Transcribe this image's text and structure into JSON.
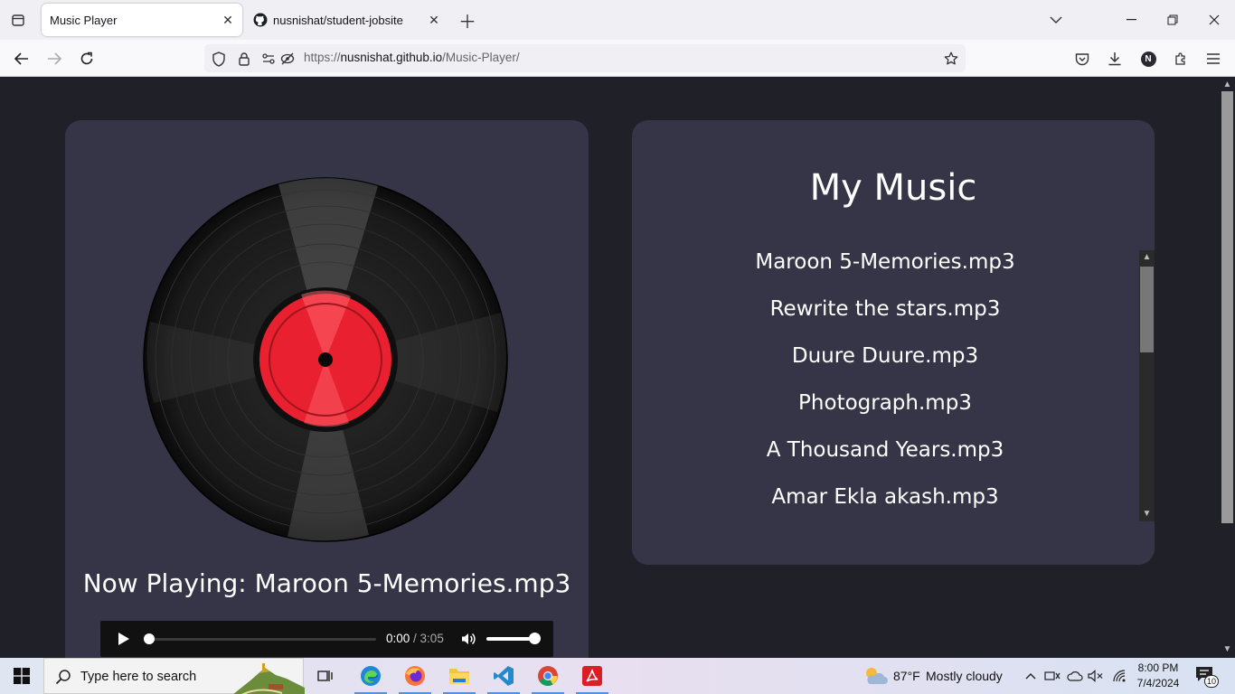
{
  "browser": {
    "tabs": [
      {
        "title": "Music Player",
        "active": true
      },
      {
        "title": "nusnishat/student-jobsite",
        "active": false
      }
    ],
    "url": {
      "scheme": "https://",
      "host": "nusnishat.github.io",
      "path": "/Music-Player/"
    },
    "profile_initial": "N"
  },
  "player": {
    "now_playing": "Now Playing: Maroon 5-Memories.mp3",
    "current_time": "0:00",
    "time_separator": " / ",
    "duration": "3:05",
    "progress_fraction": 0.0,
    "volume_fraction": 1.0
  },
  "music": {
    "title": "My Music",
    "songs": [
      "Maroon 5-Memories.mp3",
      "Rewrite the stars.mp3",
      "Duure Duure.mp3",
      "Photograph.mp3",
      "A Thousand Years.mp3",
      "Amar Ekla akash.mp3"
    ]
  },
  "taskbar": {
    "search_placeholder": "Type here to search",
    "weather_temp": "87°F",
    "weather_text": "Mostly cloudy",
    "time": "8:00 PM",
    "date": "7/4/2024",
    "notification_count": "10",
    "apps": [
      "task-view",
      "edge",
      "firefox",
      "file-explorer",
      "vscode",
      "chrome",
      "acrobat"
    ]
  },
  "colors": {
    "page_bg": "#1f2028",
    "card_bg": "#363547",
    "label_red": "#e8202f",
    "audio_bg": "#111111"
  }
}
